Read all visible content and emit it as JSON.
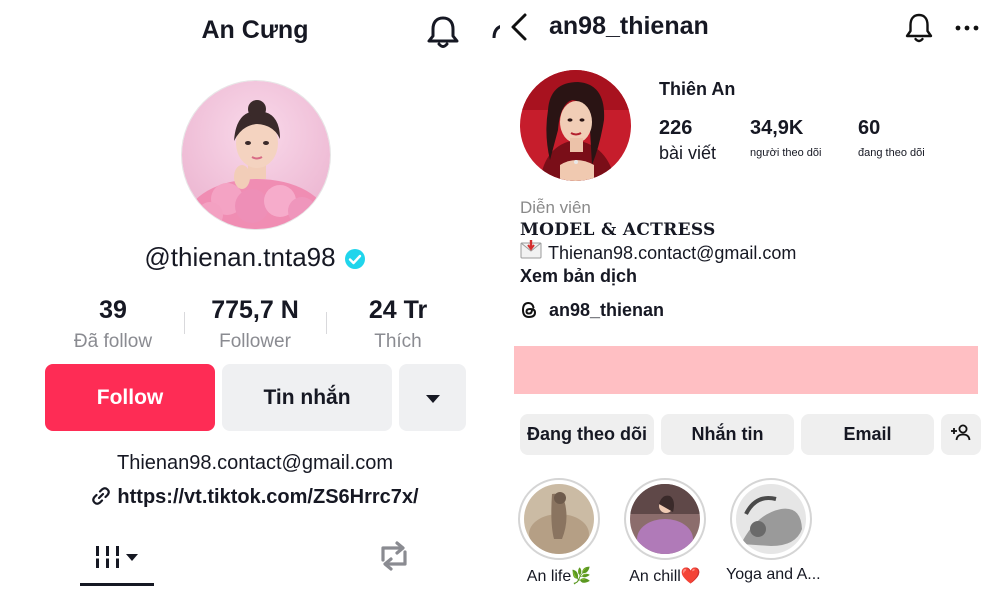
{
  "tiktok": {
    "display_name": "An Cưng",
    "handle": "@thienan.tnta98",
    "stats": [
      {
        "value": "39",
        "label": "Đã follow"
      },
      {
        "value": "775,7 N",
        "label": "Follower"
      },
      {
        "value": "24 Tr",
        "label": "Thích"
      }
    ],
    "buttons": {
      "follow": "Follow",
      "message": "Tin nhắn"
    },
    "email": "Thienan98.contact@gmail.com",
    "link": "https://vt.tiktok.com/ZS6Hrrc7x/",
    "icons": [
      "bell-icon",
      "verified-badge-icon",
      "chevron-down-icon",
      "link-icon",
      "grid-tab-icon",
      "repost-icon"
    ],
    "colors": {
      "follow_button": "#fe2c55",
      "verified": "#20d5ec"
    }
  },
  "instagram": {
    "username": "an98_thienan",
    "name": "Thiên An",
    "stats": [
      {
        "value": "226",
        "label": "bài viết"
      },
      {
        "value": "34,9K",
        "label": "người theo dõi"
      },
      {
        "value": "60",
        "label": "đang theo dõi"
      }
    ],
    "category": "Diễn viên",
    "bio": "MODEL & ACTRESS",
    "email": "Thienan98.contact@gmail.com",
    "translate": "Xem bản dịch",
    "threads_handle": "an98_thienan",
    "buttons": {
      "following": "Đang theo dõi",
      "message": "Nhắn tin",
      "email": "Email"
    },
    "highlights": [
      {
        "label": "An life🌿"
      },
      {
        "label": "An chill❤️"
      },
      {
        "label": "Yoga and A..."
      }
    ],
    "icons": [
      "back-arrow-icon",
      "bell-icon",
      "more-icon",
      "envelope-icon",
      "threads-icon",
      "add-person-icon"
    ],
    "colors": {
      "banner": "#ffbfc3"
    }
  }
}
